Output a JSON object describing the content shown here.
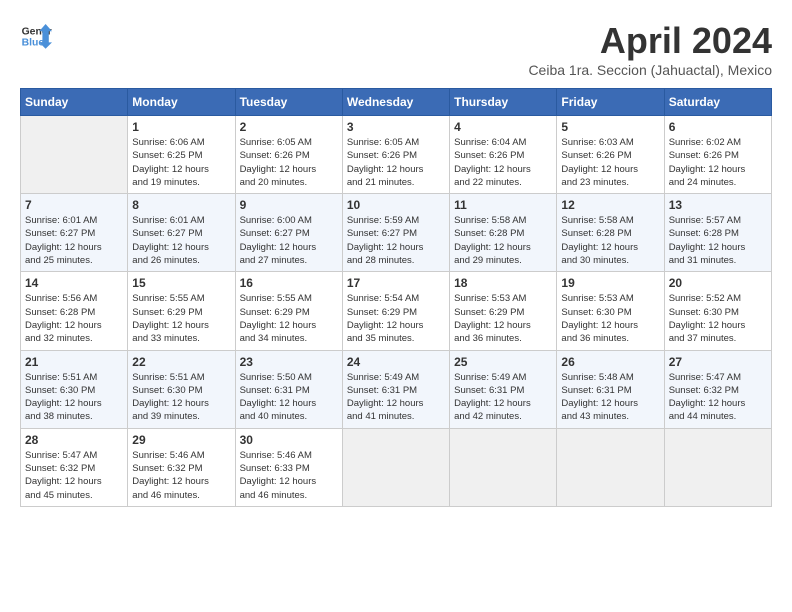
{
  "header": {
    "logo_line1": "General",
    "logo_line2": "Blue",
    "month_title": "April 2024",
    "location": "Ceiba 1ra. Seccion (Jahuactal), Mexico"
  },
  "weekdays": [
    "Sunday",
    "Monday",
    "Tuesday",
    "Wednesday",
    "Thursday",
    "Friday",
    "Saturday"
  ],
  "weeks": [
    [
      {
        "day": "",
        "info": ""
      },
      {
        "day": "1",
        "info": "Sunrise: 6:06 AM\nSunset: 6:25 PM\nDaylight: 12 hours\nand 19 minutes."
      },
      {
        "day": "2",
        "info": "Sunrise: 6:05 AM\nSunset: 6:26 PM\nDaylight: 12 hours\nand 20 minutes."
      },
      {
        "day": "3",
        "info": "Sunrise: 6:05 AM\nSunset: 6:26 PM\nDaylight: 12 hours\nand 21 minutes."
      },
      {
        "day": "4",
        "info": "Sunrise: 6:04 AM\nSunset: 6:26 PM\nDaylight: 12 hours\nand 22 minutes."
      },
      {
        "day": "5",
        "info": "Sunrise: 6:03 AM\nSunset: 6:26 PM\nDaylight: 12 hours\nand 23 minutes."
      },
      {
        "day": "6",
        "info": "Sunrise: 6:02 AM\nSunset: 6:26 PM\nDaylight: 12 hours\nand 24 minutes."
      }
    ],
    [
      {
        "day": "7",
        "info": "Sunrise: 6:01 AM\nSunset: 6:27 PM\nDaylight: 12 hours\nand 25 minutes."
      },
      {
        "day": "8",
        "info": "Sunrise: 6:01 AM\nSunset: 6:27 PM\nDaylight: 12 hours\nand 26 minutes."
      },
      {
        "day": "9",
        "info": "Sunrise: 6:00 AM\nSunset: 6:27 PM\nDaylight: 12 hours\nand 27 minutes."
      },
      {
        "day": "10",
        "info": "Sunrise: 5:59 AM\nSunset: 6:27 PM\nDaylight: 12 hours\nand 28 minutes."
      },
      {
        "day": "11",
        "info": "Sunrise: 5:58 AM\nSunset: 6:28 PM\nDaylight: 12 hours\nand 29 minutes."
      },
      {
        "day": "12",
        "info": "Sunrise: 5:58 AM\nSunset: 6:28 PM\nDaylight: 12 hours\nand 30 minutes."
      },
      {
        "day": "13",
        "info": "Sunrise: 5:57 AM\nSunset: 6:28 PM\nDaylight: 12 hours\nand 31 minutes."
      }
    ],
    [
      {
        "day": "14",
        "info": "Sunrise: 5:56 AM\nSunset: 6:28 PM\nDaylight: 12 hours\nand 32 minutes."
      },
      {
        "day": "15",
        "info": "Sunrise: 5:55 AM\nSunset: 6:29 PM\nDaylight: 12 hours\nand 33 minutes."
      },
      {
        "day": "16",
        "info": "Sunrise: 5:55 AM\nSunset: 6:29 PM\nDaylight: 12 hours\nand 34 minutes."
      },
      {
        "day": "17",
        "info": "Sunrise: 5:54 AM\nSunset: 6:29 PM\nDaylight: 12 hours\nand 35 minutes."
      },
      {
        "day": "18",
        "info": "Sunrise: 5:53 AM\nSunset: 6:29 PM\nDaylight: 12 hours\nand 36 minutes."
      },
      {
        "day": "19",
        "info": "Sunrise: 5:53 AM\nSunset: 6:30 PM\nDaylight: 12 hours\nand 36 minutes."
      },
      {
        "day": "20",
        "info": "Sunrise: 5:52 AM\nSunset: 6:30 PM\nDaylight: 12 hours\nand 37 minutes."
      }
    ],
    [
      {
        "day": "21",
        "info": "Sunrise: 5:51 AM\nSunset: 6:30 PM\nDaylight: 12 hours\nand 38 minutes."
      },
      {
        "day": "22",
        "info": "Sunrise: 5:51 AM\nSunset: 6:30 PM\nDaylight: 12 hours\nand 39 minutes."
      },
      {
        "day": "23",
        "info": "Sunrise: 5:50 AM\nSunset: 6:31 PM\nDaylight: 12 hours\nand 40 minutes."
      },
      {
        "day": "24",
        "info": "Sunrise: 5:49 AM\nSunset: 6:31 PM\nDaylight: 12 hours\nand 41 minutes."
      },
      {
        "day": "25",
        "info": "Sunrise: 5:49 AM\nSunset: 6:31 PM\nDaylight: 12 hours\nand 42 minutes."
      },
      {
        "day": "26",
        "info": "Sunrise: 5:48 AM\nSunset: 6:31 PM\nDaylight: 12 hours\nand 43 minutes."
      },
      {
        "day": "27",
        "info": "Sunrise: 5:47 AM\nSunset: 6:32 PM\nDaylight: 12 hours\nand 44 minutes."
      }
    ],
    [
      {
        "day": "28",
        "info": "Sunrise: 5:47 AM\nSunset: 6:32 PM\nDaylight: 12 hours\nand 45 minutes."
      },
      {
        "day": "29",
        "info": "Sunrise: 5:46 AM\nSunset: 6:32 PM\nDaylight: 12 hours\nand 46 minutes."
      },
      {
        "day": "30",
        "info": "Sunrise: 5:46 AM\nSunset: 6:33 PM\nDaylight: 12 hours\nand 46 minutes."
      },
      {
        "day": "",
        "info": ""
      },
      {
        "day": "",
        "info": ""
      },
      {
        "day": "",
        "info": ""
      },
      {
        "day": "",
        "info": ""
      }
    ]
  ]
}
